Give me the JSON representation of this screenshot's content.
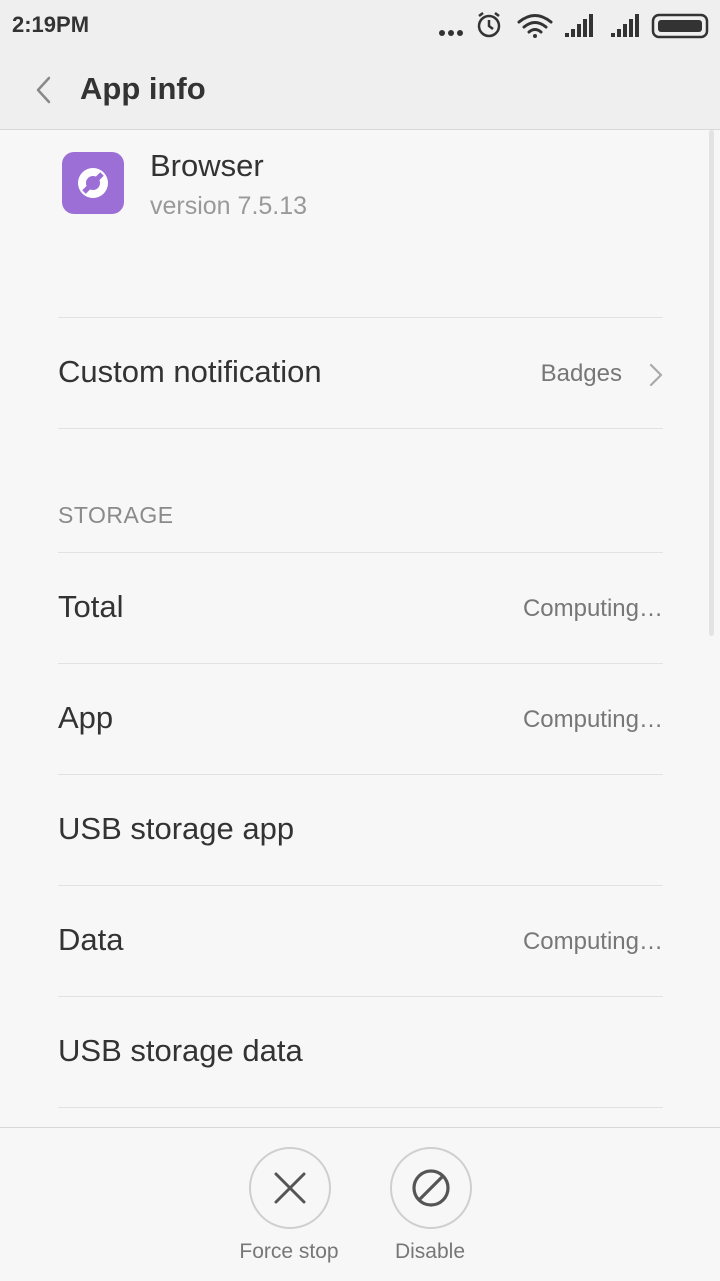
{
  "status_bar": {
    "time": "2:19PM",
    "icons": [
      "more-dots-icon",
      "alarm-icon",
      "wifi-icon",
      "signal-icon",
      "signal-icon",
      "battery-icon"
    ]
  },
  "app_bar": {
    "title": "App info",
    "back_icon": "back-chevron-icon"
  },
  "app": {
    "name": "Browser",
    "version": "version 7.5.13",
    "icon_color": "#9b6fd6"
  },
  "notification_row": {
    "label": "Custom notification",
    "value": "Badges"
  },
  "storage": {
    "section_label": "STORAGE",
    "rows": [
      {
        "label": "Total",
        "value": "Computing…"
      },
      {
        "label": "App",
        "value": "Computing…"
      },
      {
        "label": "USB storage app",
        "value": ""
      },
      {
        "label": "Data",
        "value": "Computing…"
      },
      {
        "label": "USB storage data",
        "value": ""
      }
    ]
  },
  "actions": {
    "force_stop": "Force stop",
    "disable": "Disable"
  }
}
